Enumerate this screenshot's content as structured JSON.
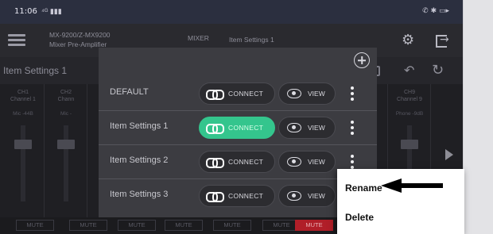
{
  "status_bar": {
    "time": "11:06",
    "signal": "⁴ᴳ ▮▮▮",
    "icons": "✆ ✱ ▭▸"
  },
  "app_bar": {
    "model_line1": "MX-9200/Z-MX9200",
    "model_line2": "Mixer Pre-Amplifier",
    "section": "MIXER",
    "subtitle": "Item Settings 1",
    "icons": [
      "menu-icon",
      "gear-icon",
      "exit-icon"
    ]
  },
  "toolbar": {
    "title": "Item Settings 1",
    "icons": [
      "save-icon",
      "undo-icon",
      "refresh-icon"
    ]
  },
  "channels": [
    {
      "label": "CH1\nChannel 1",
      "sub": "Mic -44B"
    },
    {
      "label": "CH2\nChann",
      "sub": "Mic -"
    },
    {
      "label": "",
      "sub": ""
    },
    {
      "label": "",
      "sub": ""
    },
    {
      "label": "",
      "sub": ""
    },
    {
      "label": "",
      "sub": ""
    },
    {
      "label": "",
      "sub": ""
    },
    {
      "label": "",
      "sub": ""
    },
    {
      "label": "l 8",
      "sub": "ule"
    },
    {
      "label": "CH9\nChannel 9",
      "sub": "Phone -9dB"
    }
  ],
  "mute_buttons": [
    {
      "label": "MUTE",
      "active": false
    },
    {
      "label": "MUTE",
      "active": false
    },
    {
      "label": "MUTE",
      "active": false
    },
    {
      "label": "MUTE",
      "active": false
    },
    {
      "label": "MUTE",
      "active": false
    },
    {
      "label": "MUTE",
      "active": false
    },
    {
      "label": "MUTE",
      "active": true
    }
  ],
  "dialog": {
    "add_icon": "plus-circle-icon",
    "rows": [
      {
        "name": "DEFAULT",
        "connect": "CONNECT",
        "view": "VIEW",
        "active": false
      },
      {
        "name": "Item Settings 1",
        "connect": "CONNECT",
        "view": "VIEW",
        "active": true
      },
      {
        "name": "Item Settings 2",
        "connect": "CONNECT",
        "view": "VIEW",
        "active": false
      },
      {
        "name": "Item Settings 3",
        "connect": "CONNECT",
        "view": "VIEW",
        "active": false
      }
    ]
  },
  "popup_menu": {
    "rename": "Rename",
    "delete": "Delete"
  },
  "colors": {
    "active_connect": "#34c58d",
    "mute_active": "#b01e28",
    "dialog_bg": "#3c3c41",
    "arrow": "#000000"
  }
}
